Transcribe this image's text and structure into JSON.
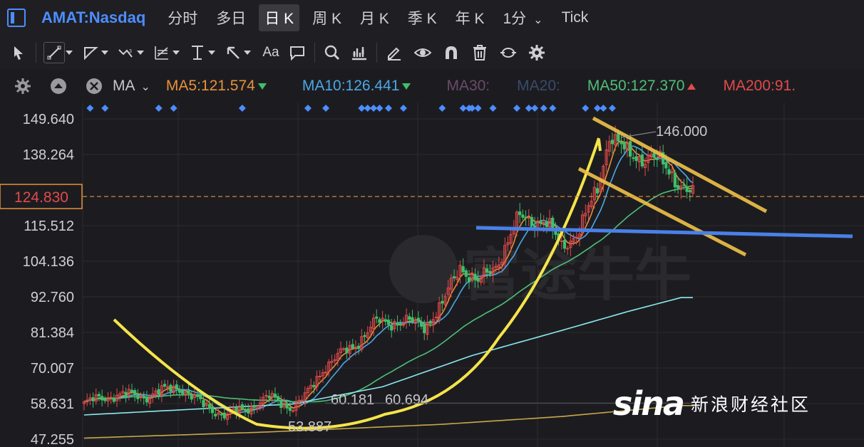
{
  "header": {
    "ticker": "AMAT:Nasdaq",
    "periods": [
      "分时",
      "多日",
      "日 K",
      "周 K",
      "月 K",
      "季 K",
      "年 K",
      "1分",
      "Tick"
    ],
    "active_period": 2,
    "accent": "#4d8dff"
  },
  "toolbar": {
    "icons": [
      "cursor-icon",
      "line-tool-icon",
      "polygon-tool-icon",
      "wave-tool-icon",
      "fibonacci-icon",
      "measure-icon",
      "arrow-tool-icon",
      "text-tool-icon",
      "comment-icon",
      "zoom-icon",
      "indicator-icon",
      "pen-icon",
      "eye-icon",
      "magnet-icon",
      "trash-icon",
      "sync-icon",
      "gear-icon"
    ],
    "text_tool_label": "Aa"
  },
  "ma_bar": {
    "label": "MA",
    "items": [
      {
        "name": "MA5",
        "text": "MA5:121.574",
        "color": "#e8913a",
        "trend": "down"
      },
      {
        "name": "MA10",
        "text": "MA10:126.441",
        "color": "#4aa8e8",
        "trend": "down"
      },
      {
        "name": "MA30",
        "text": "MA30:",
        "color": "#6a4a6a",
        "trend": ""
      },
      {
        "name": "MA20",
        "text": "MA20:",
        "color": "#3a4a6a",
        "trend": ""
      },
      {
        "name": "MA50",
        "text": "MA50:127.370",
        "color": "#4fbf78",
        "trend": "up"
      },
      {
        "name": "MA200",
        "text": "MA200:91.",
        "color": "#e24a4a",
        "trend": ""
      }
    ]
  },
  "chart_data": {
    "type": "candlestick",
    "y_ticks": [
      "149.640",
      "138.264",
      "115.512",
      "104.136",
      "92.760",
      "81.384",
      "70.007",
      "58.631",
      "47.255"
    ],
    "y_tick_values": [
      149.64,
      138.264,
      115.512,
      104.136,
      92.76,
      81.384,
      70.007,
      58.631,
      47.255
    ],
    "ylim": [
      47.255,
      149.64
    ],
    "current_price": "124.830",
    "current_price_value": 124.83,
    "annotations": [
      {
        "text": "146.000",
        "value": 146.0
      },
      {
        "text": "60.181",
        "value": 60.181
      },
      {
        "text": "60.694",
        "value": 60.694
      },
      {
        "text": "53.887",
        "value": 53.887
      }
    ],
    "anchors": [
      [
        0,
        58.6
      ],
      [
        10,
        61.5
      ],
      [
        20,
        61.0
      ],
      [
        32,
        64.0
      ],
      [
        40,
        58.0
      ],
      [
        48,
        54.8
      ],
      [
        54,
        57.0
      ],
      [
        62,
        60.5
      ],
      [
        70,
        57.5
      ],
      [
        74,
        60.5
      ],
      [
        80,
        70.0
      ],
      [
        90,
        77.0
      ],
      [
        98,
        84.5
      ],
      [
        106,
        85.0
      ],
      [
        114,
        83.5
      ],
      [
        120,
        90.0
      ],
      [
        126,
        103.0
      ],
      [
        132,
        97.0
      ],
      [
        138,
        103.0
      ],
      [
        146,
        118.0
      ],
      [
        154,
        117.0
      ],
      [
        160,
        109.0
      ],
      [
        166,
        114.0
      ],
      [
        172,
        127.0
      ],
      [
        176,
        145.0
      ],
      [
        182,
        138.0
      ],
      [
        190,
        137.5
      ],
      [
        196,
        133.0
      ],
      [
        200,
        129.0
      ],
      [
        204,
        124.8
      ]
    ],
    "n_bars": 205,
    "ma_lines": [
      {
        "name": "MA5",
        "color": "#e8913a",
        "period": 5
      },
      {
        "name": "MA10",
        "color": "#4aa8e8",
        "period": 10
      },
      {
        "name": "MA50",
        "color": "#4fbf78",
        "period": 50
      },
      {
        "name": "long-ma",
        "color": "#8de8f0",
        "anchors": [
          [
            0,
            55.0
          ],
          [
            40,
            57.0
          ],
          [
            70,
            58.5
          ],
          [
            100,
            64.0
          ],
          [
            130,
            74.0
          ],
          [
            160,
            82.0
          ],
          [
            182,
            88.0
          ],
          [
            200,
            92.5
          ]
        ]
      },
      {
        "name": "MA200",
        "color": "#c9a84a",
        "anchors": [
          [
            0,
            47.6
          ],
          [
            60,
            49.5
          ],
          [
            120,
            52.0
          ],
          [
            160,
            54.5
          ],
          [
            200,
            58.0
          ]
        ]
      }
    ],
    "buy_signals": [
      2,
      7,
      25,
      30,
      53,
      75,
      81,
      93,
      95,
      97,
      99,
      102,
      107,
      120,
      127,
      129,
      130,
      132,
      137,
      145,
      149,
      151,
      154,
      157,
      168,
      172,
      174,
      177
    ]
  },
  "drawings": {
    "watermark": "富途牛牛"
  },
  "logo": {
    "mark": "sina",
    "text": "新浪财经社区"
  }
}
